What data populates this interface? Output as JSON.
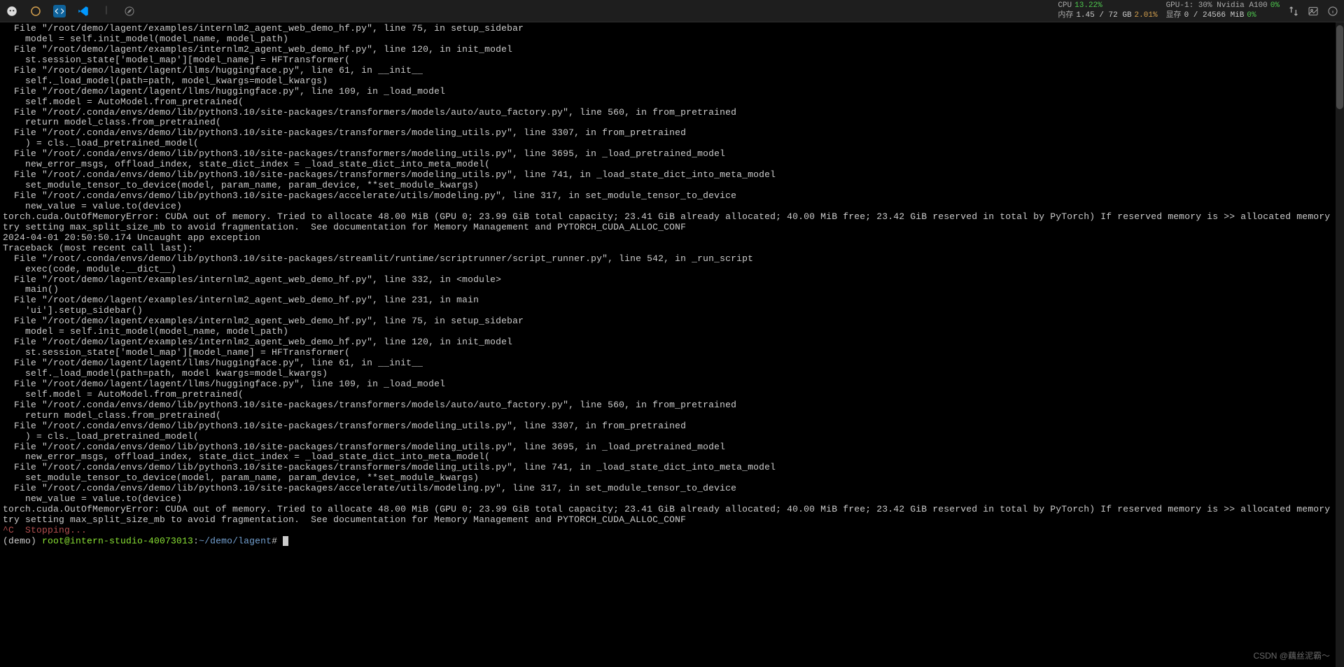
{
  "topbar": {
    "icons": [
      "cat",
      "ring",
      "code",
      "vscode",
      "divider",
      "compass"
    ],
    "stats": {
      "cpu_label": "CPU",
      "cpu_value": "13.22%",
      "mem_label": "内存",
      "mem_value": "1.45 / 72 GB",
      "mem_percent": "2.01%",
      "gpu_label": "GPU-1: 30% Nvidia A100",
      "gpu_value": "0%",
      "vram_label": "显存",
      "vram_value": "0 / 24566 MiB",
      "vram_percent": "0%"
    }
  },
  "terminal": {
    "lines": [
      "  File \"/root/demo/lagent/examples/internlm2_agent_web_demo_hf.py\", line 75, in setup_sidebar",
      "    model = self.init_model(model_name, model_path)",
      "  File \"/root/demo/lagent/examples/internlm2_agent_web_demo_hf.py\", line 120, in init_model",
      "    st.session_state['model_map'][model_name] = HFTransformer(",
      "  File \"/root/demo/lagent/lagent/llms/huggingface.py\", line 61, in __init__",
      "    self._load_model(path=path, model_kwargs=model_kwargs)",
      "  File \"/root/demo/lagent/lagent/llms/huggingface.py\", line 109, in _load_model",
      "    self.model = AutoModel.from_pretrained(",
      "  File \"/root/.conda/envs/demo/lib/python3.10/site-packages/transformers/models/auto/auto_factory.py\", line 560, in from_pretrained",
      "    return model_class.from_pretrained(",
      "  File \"/root/.conda/envs/demo/lib/python3.10/site-packages/transformers/modeling_utils.py\", line 3307, in from_pretrained",
      "    ) = cls._load_pretrained_model(",
      "  File \"/root/.conda/envs/demo/lib/python3.10/site-packages/transformers/modeling_utils.py\", line 3695, in _load_pretrained_model",
      "    new_error_msgs, offload_index, state_dict_index = _load_state_dict_into_meta_model(",
      "  File \"/root/.conda/envs/demo/lib/python3.10/site-packages/transformers/modeling_utils.py\", line 741, in _load_state_dict_into_meta_model",
      "    set_module_tensor_to_device(model, param_name, param_device, **set_module_kwargs)",
      "  File \"/root/.conda/envs/demo/lib/python3.10/site-packages/accelerate/utils/modeling.py\", line 317, in set_module_tensor_to_device",
      "    new_value = value.to(device)",
      "torch.cuda.OutOfMemoryError: CUDA out of memory. Tried to allocate 48.00 MiB (GPU 0; 23.99 GiB total capacity; 23.41 GiB already allocated; 40.00 MiB free; 23.42 GiB reserved in total by PyTorch) If reserved memory is >> allocated memory",
      "try setting max_split_size_mb to avoid fragmentation.  See documentation for Memory Management and PYTORCH_CUDA_ALLOC_CONF",
      "2024-04-01 20:50:50.174 Uncaught app exception",
      "Traceback (most recent call last):",
      "  File \"/root/.conda/envs/demo/lib/python3.10/site-packages/streamlit/runtime/scriptrunner/script_runner.py\", line 542, in _run_script",
      "    exec(code, module.__dict__)",
      "  File \"/root/demo/lagent/examples/internlm2_agent_web_demo_hf.py\", line 332, in <module>",
      "    main()",
      "  File \"/root/demo/lagent/examples/internlm2_agent_web_demo_hf.py\", line 231, in main",
      "    'ui'].setup_sidebar()",
      "  File \"/root/demo/lagent/examples/internlm2_agent_web_demo_hf.py\", line 75, in setup_sidebar",
      "    model = self.init_model(model_name, model_path)",
      "  File \"/root/demo/lagent/examples/internlm2_agent_web_demo_hf.py\", line 120, in init_model",
      "    st.session_state['model_map'][model_name] = HFTransformer(",
      "  File \"/root/demo/lagent/lagent/llms/huggingface.py\", line 61, in __init__",
      "    self._load_model(path=path, model kwargs=model_kwargs)",
      "  File \"/root/demo/lagent/lagent/llms/huggingface.py\", line 109, in _load_model",
      "    self.model = AutoModel.from_pretrained(",
      "  File \"/root/.conda/envs/demo/lib/python3.10/site-packages/transformers/models/auto/auto_factory.py\", line 560, in from_pretrained",
      "    return model_class.from_pretrained(",
      "  File \"/root/.conda/envs/demo/lib/python3.10/site-packages/transformers/modeling_utils.py\", line 3307, in from_pretrained",
      "    ) = cls._load_pretrained_model(",
      "  File \"/root/.conda/envs/demo/lib/python3.10/site-packages/transformers/modeling_utils.py\", line 3695, in _load_pretrained_model",
      "    new_error_msgs, offload_index, state_dict_index = _load_state_dict_into_meta_model(",
      "  File \"/root/.conda/envs/demo/lib/python3.10/site-packages/transformers/modeling_utils.py\", line 741, in _load_state_dict_into_meta_model",
      "    set_module_tensor_to_device(model, param_name, param_device, **set_module_kwargs)",
      "  File \"/root/.conda/envs/demo/lib/python3.10/site-packages/accelerate/utils/modeling.py\", line 317, in set_module_tensor_to_device",
      "    new_value = value.to(device)",
      "torch.cuda.OutOfMemoryError: CUDA out of memory. Tried to allocate 48.00 MiB (GPU 0; 23.99 GiB total capacity; 23.41 GiB already allocated; 40.00 MiB free; 23.42 GiB reserved in total by PyTorch) If reserved memory is >> allocated memory",
      "try setting max_split_size_mb to avoid fragmentation.  See documentation for Memory Management and PYTORCH_CUDA_ALLOC_CONF"
    ],
    "stopping": "^C  Stopping...",
    "prompt": {
      "env": "(demo) ",
      "user": "root@intern-studio-40073013",
      "colon": ":",
      "path": "~/demo/lagent",
      "suffix": "# "
    }
  },
  "watermark": "CSDN @藕丝泥霸～"
}
